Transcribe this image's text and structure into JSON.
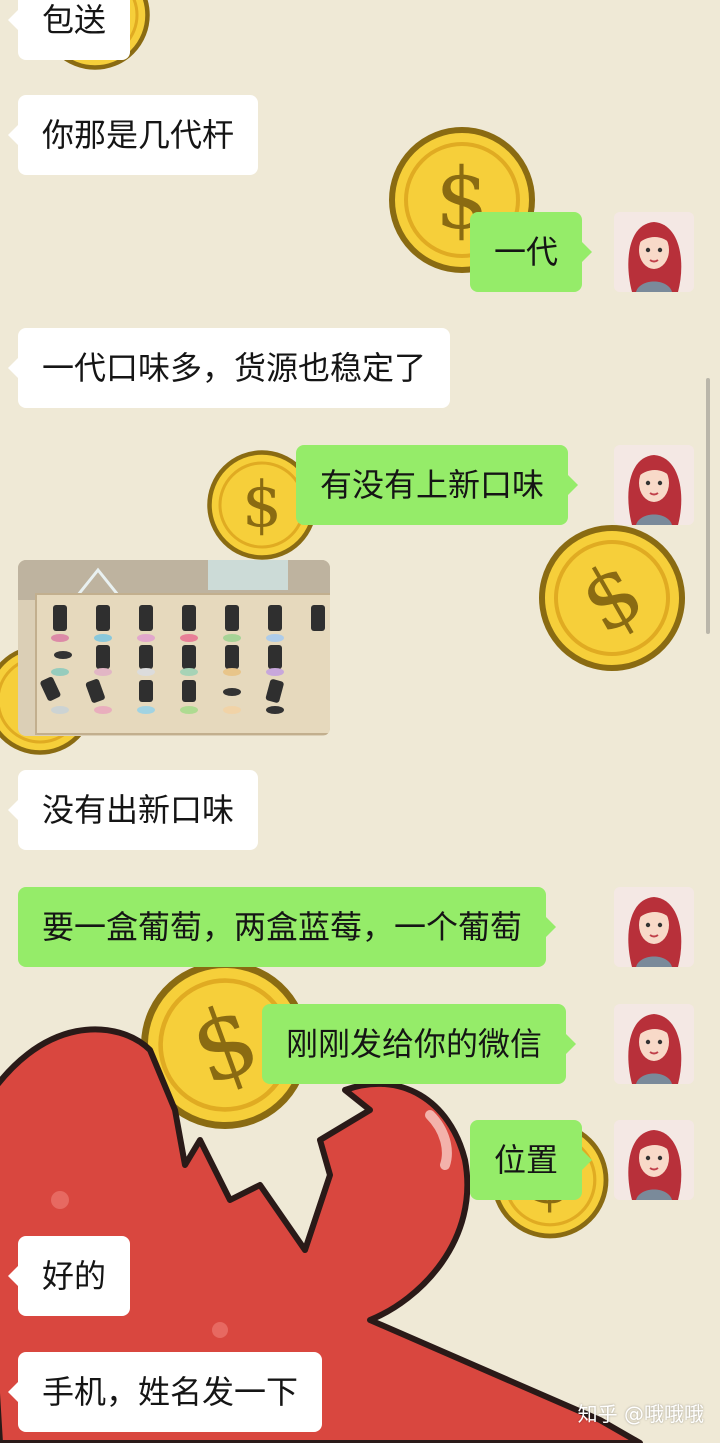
{
  "messages": [
    {
      "side": "in",
      "text": "包送"
    },
    {
      "side": "in",
      "text": "你那是几代杆"
    },
    {
      "side": "out",
      "text": "一代"
    },
    {
      "side": "in",
      "text": "一代口味多，货源也稳定了"
    },
    {
      "side": "out",
      "text": "有没有上新口味"
    },
    {
      "side": "in",
      "type": "image",
      "description": "product display"
    },
    {
      "side": "in",
      "text": "没有出新口味"
    },
    {
      "side": "out",
      "text": "要一盒葡萄，两盒蓝莓，一个葡萄"
    },
    {
      "side": "out",
      "text": "刚刚发给你的微信"
    },
    {
      "side": "out",
      "text": "位置"
    },
    {
      "side": "in",
      "text": "好的"
    },
    {
      "side": "in",
      "text": "手机，姓名发一下"
    }
  ],
  "watermark": {
    "text": "知乎 @哦哦哦"
  },
  "colors": {
    "outgoing_bubble": "#95ec69",
    "incoming_bubble": "#ffffff",
    "background": "#efe9d6"
  }
}
